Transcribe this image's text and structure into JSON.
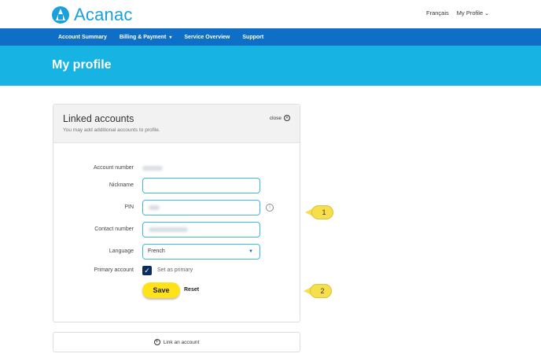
{
  "brand": {
    "name": "Acanac"
  },
  "top_links": {
    "language": "Français",
    "profile": "My Profile"
  },
  "nav": {
    "items": [
      {
        "label": "Account Summary",
        "has_menu": false
      },
      {
        "label": "Billing & Payment",
        "has_menu": true
      },
      {
        "label": "Service Overview",
        "has_menu": false
      },
      {
        "label": "Support",
        "has_menu": false
      }
    ]
  },
  "page": {
    "title": "My profile"
  },
  "panel": {
    "title": "Linked accounts",
    "subtitle": "You may add additional accounts to profile.",
    "close_label": "close",
    "fields": {
      "account_number_label": "Account number",
      "nickname_label": "Nickname",
      "nickname_value": "",
      "pin_label": "PIN",
      "contact_label": "Contact number",
      "language_label": "Language",
      "language_value": "French",
      "primary_label": "Primary account",
      "primary_checkbox_label": "Set as primary",
      "primary_checked": true
    },
    "save_label": "Save",
    "reset_label": "Reset"
  },
  "link_account": {
    "label": "Link an account"
  },
  "callouts": [
    "1",
    "2"
  ],
  "colors": {
    "brand": "#1aa0dc",
    "nav": "#0f6fc6",
    "hero": "#17b4e3",
    "save": "#ffe21a",
    "field_border": "#3fb8e6"
  }
}
